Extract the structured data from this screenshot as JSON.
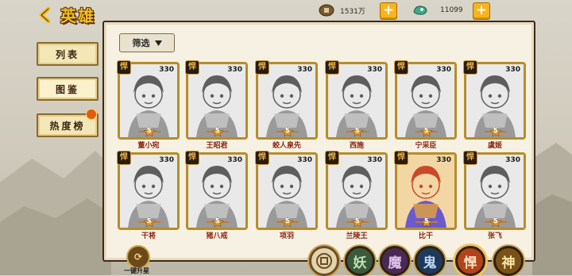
{
  "header": {
    "title": "英雄",
    "resources": [
      {
        "name": "coin-icon",
        "amount": "1531万"
      },
      {
        "name": "jade-icon",
        "amount": "11099"
      }
    ]
  },
  "sidebar": {
    "items": [
      {
        "label": "列表"
      },
      {
        "label": "图鉴"
      },
      {
        "label": "热度榜"
      }
    ]
  },
  "filter": {
    "label": "筛选"
  },
  "heroes": [
    {
      "name": "董小宛",
      "level": "330",
      "type": "悍",
      "stars": "5"
    },
    {
      "name": "王昭君",
      "level": "330",
      "type": "悍",
      "stars": "5"
    },
    {
      "name": "蛟人泉先",
      "level": "330",
      "type": "悍",
      "stars": "5"
    },
    {
      "name": "西施",
      "level": "330",
      "type": "悍",
      "stars": "5"
    },
    {
      "name": "宁采臣",
      "level": "330",
      "type": "悍",
      "stars": "5"
    },
    {
      "name": "虞姬",
      "level": "330",
      "type": "悍",
      "stars": "5"
    },
    {
      "name": "干将",
      "level": "330",
      "type": "悍",
      "stars": "5"
    },
    {
      "name": "猪八戒",
      "level": "330",
      "type": "悍",
      "stars": "5"
    },
    {
      "name": "项羽",
      "level": "330",
      "type": "悍",
      "stars": "5"
    },
    {
      "name": "兰陵王",
      "level": "330",
      "type": "悍",
      "stars": "5"
    },
    {
      "name": "比干",
      "level": "330",
      "type": "悍",
      "stars": "5"
    },
    {
      "name": "张飞",
      "level": "330",
      "type": "悍",
      "stars": "5"
    }
  ],
  "bottom": {
    "upgrade_label": "一键升星",
    "factions": [
      "妖",
      "魔",
      "鬼",
      "悍",
      "神"
    ]
  },
  "colors": {
    "accent": "#f6b51c",
    "card_border": "#b68d2a",
    "name_text": "#8a2412"
  }
}
